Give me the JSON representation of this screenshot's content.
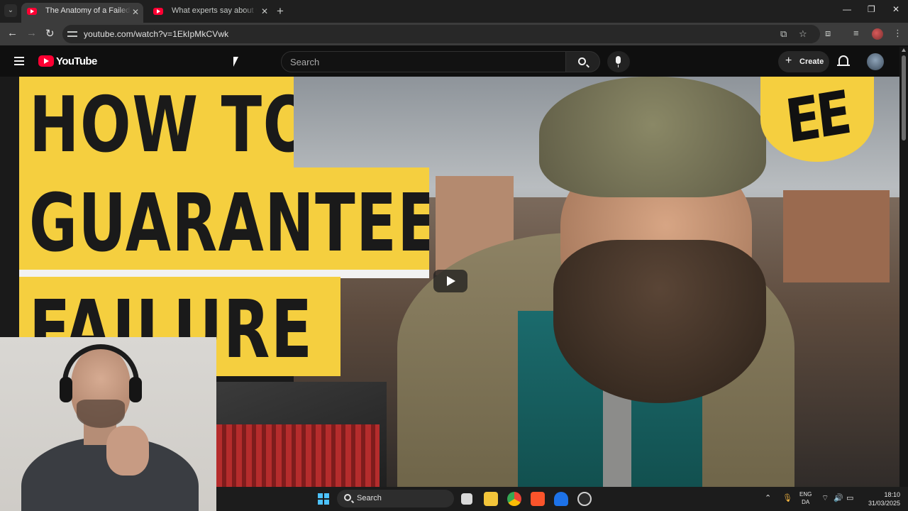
{
  "browser": {
    "tabs": [
      {
        "title": "The Anatomy of a Failed Econo",
        "active": true
      },
      {
        "title": "What experts say about who ha",
        "active": false
      }
    ],
    "url": "youtube.com/watch?v=1EkIpMkCVwk"
  },
  "youtube": {
    "brand": "YouTube",
    "search_placeholder": "Search",
    "create_label": "Create"
  },
  "video": {
    "thumbnail_lines": [
      "HOW TO",
      "GUARANTEE",
      "FAILURE"
    ],
    "badge_text": "EE"
  },
  "taskbar": {
    "search_label": "Search",
    "language": "ENG",
    "region": "DA",
    "time": "18:10",
    "date": "31/03/2025"
  },
  "colors": {
    "youtube_red": "#ff0033",
    "headline_yellow": "#f5cf3f",
    "masthead_bg": "#0f0f0f",
    "chrome_tab_active": "#3c3c3c"
  }
}
